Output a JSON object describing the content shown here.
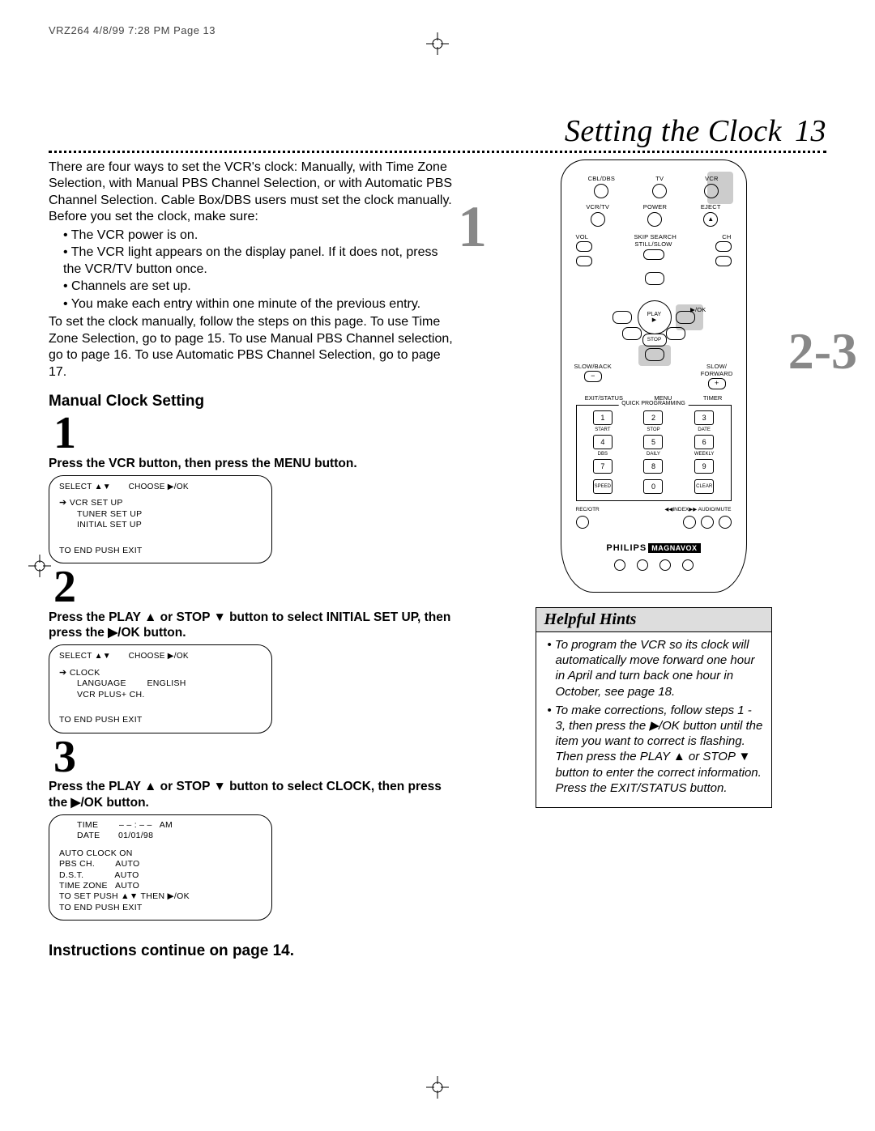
{
  "print_header": "VRZ264  4/8/99 7:28 PM  Page 13",
  "title": "Setting the Clock",
  "page_number": "13",
  "intro": "There are four ways to set the VCR's clock: Manually, with Time Zone Selection, with Manual PBS Channel Selection, or with Automatic PBS Channel Selection. Cable Box/DBS users must set the clock manually. Before you set the clock, make sure:",
  "bullets": [
    "The VCR power is on.",
    "The VCR light appears on the display panel. If it does not, press the VCR/TV button once.",
    "Channels are set up.",
    "You make each entry within one minute of the previous entry."
  ],
  "intro2": "To set the clock manually, follow the steps on this page. To use Time Zone Selection, go to page 15. To use Manual PBS Channel selection, go to page 16. To use Automatic PBS Channel Selection, go to page 17.",
  "section_heading": "Manual Clock Setting",
  "steps": {
    "s1": {
      "num": "1",
      "text_a": "Press the VCR button, then press the MENU button.",
      "osd_header_left": "SELECT ▲▼",
      "osd_header_right": "CHOOSE ▶/OK",
      "lines": [
        "VCR SET UP",
        "TUNER SET UP",
        "INITIAL SET UP"
      ],
      "footer": "TO END PUSH EXIT"
    },
    "s2": {
      "num": "2",
      "text_a": "Press the PLAY ▲ or STOP ▼ button to select INITIAL SET UP, then press the ▶/OK button.",
      "osd_header_left": "SELECT ▲▼",
      "osd_header_right": "CHOOSE ▶/OK",
      "lines": [
        "CLOCK",
        "LANGUAGE        ENGLISH",
        "VCR PLUS+ CH."
      ],
      "footer": "TO END PUSH EXIT"
    },
    "s3": {
      "num": "3",
      "text_a": "Press the PLAY ▲ or STOP ▼ button to select CLOCK, then press the ▶/OK button.",
      "lines": [
        "TIME        – – : – –   AM",
        "DATE       01/01/98",
        "",
        "AUTO CLOCK ON",
        "PBS CH.        AUTO",
        "D.S.T.            AUTO",
        "TIME ZONE   AUTO",
        "TO SET PUSH ▲▼ THEN ▶/OK",
        "TO END PUSH EXIT"
      ]
    }
  },
  "continue": "Instructions continue on page 14.",
  "callouts": {
    "c1": "1",
    "c23": "2-3"
  },
  "remote": {
    "row1": [
      "CBL/DBS",
      "TV",
      "VCR"
    ],
    "row2": [
      "VCR/TV",
      "POWER",
      "EJECT"
    ],
    "row3_labels": [
      "VOL",
      "SKIP SEARCH",
      "CH"
    ],
    "still_slow": "STILL/SLOW",
    "play": "PLAY",
    "ok": "▶/OK",
    "stop": "STOP",
    "slow_back": "SLOW/BACK",
    "slow_fwd": "SLOW/\nFORWARD",
    "mid": [
      "EXIT/STATUS",
      "MENU",
      "TIMER"
    ],
    "qp_title": "QUICK PROGRAMMING",
    "numlabels_top": [
      "START",
      "STOP",
      "DATE"
    ],
    "numlabels_mid": [
      "DBS",
      "DAILY",
      "WEEKLY"
    ],
    "nums": [
      "1",
      "2",
      "3",
      "4",
      "5",
      "6",
      "7",
      "8",
      "9"
    ],
    "bottomrow": [
      "SPEED",
      "0",
      "CLEAR"
    ],
    "recrow_left": "REC/OTR",
    "recrow_right": "◀◀INDEX▶▶  AUDIO/MUTE",
    "brand1": "PHILIPS",
    "brand2": "MAGNAVOX"
  },
  "hints": {
    "title": "Helpful Hints",
    "items": [
      "To program the VCR so its clock will automatically move forward one hour in April and turn back one hour in October, see page 18.",
      "To make corrections, follow steps 1 - 3, then press the ▶/OK button until the item you want to correct is flashing. Then press the PLAY ▲ or STOP ▼ button to enter the correct information. Press the EXIT/STATUS button."
    ]
  }
}
